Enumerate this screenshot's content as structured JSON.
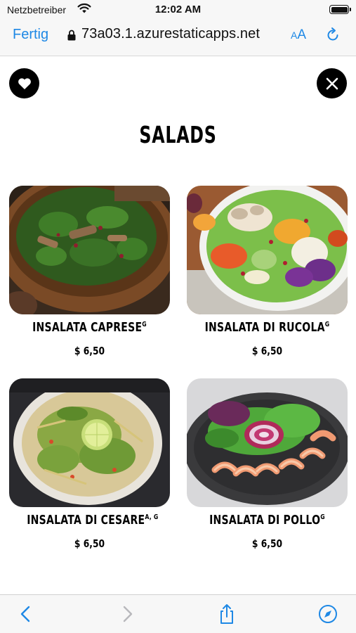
{
  "status_bar": {
    "carrier": "Netzbetreiber",
    "time": "12:02 AM"
  },
  "browser": {
    "done_label": "Fertig",
    "url": "73a03.1.azurestaticapps.net",
    "text_size_small": "A",
    "text_size_large": "A",
    "accent_color": "#1e88e5"
  },
  "page": {
    "title": "SALADS",
    "items": [
      {
        "name": "INSALATA CAPRESE",
        "allergens": "G",
        "price": "$ 6,50"
      },
      {
        "name": "INSALATA DI RUCOLA",
        "allergens": "G",
        "price": "$ 6,50"
      },
      {
        "name": "INSALATA DI CESARE",
        "allergens": "A, G",
        "price": "$ 6,50"
      },
      {
        "name": "INSALATA DI POLLO",
        "allergens": "G",
        "price": "$ 6,50"
      }
    ]
  },
  "toolbar": {
    "icons": [
      "back-icon",
      "forward-icon",
      "share-icon",
      "compass-icon"
    ]
  }
}
